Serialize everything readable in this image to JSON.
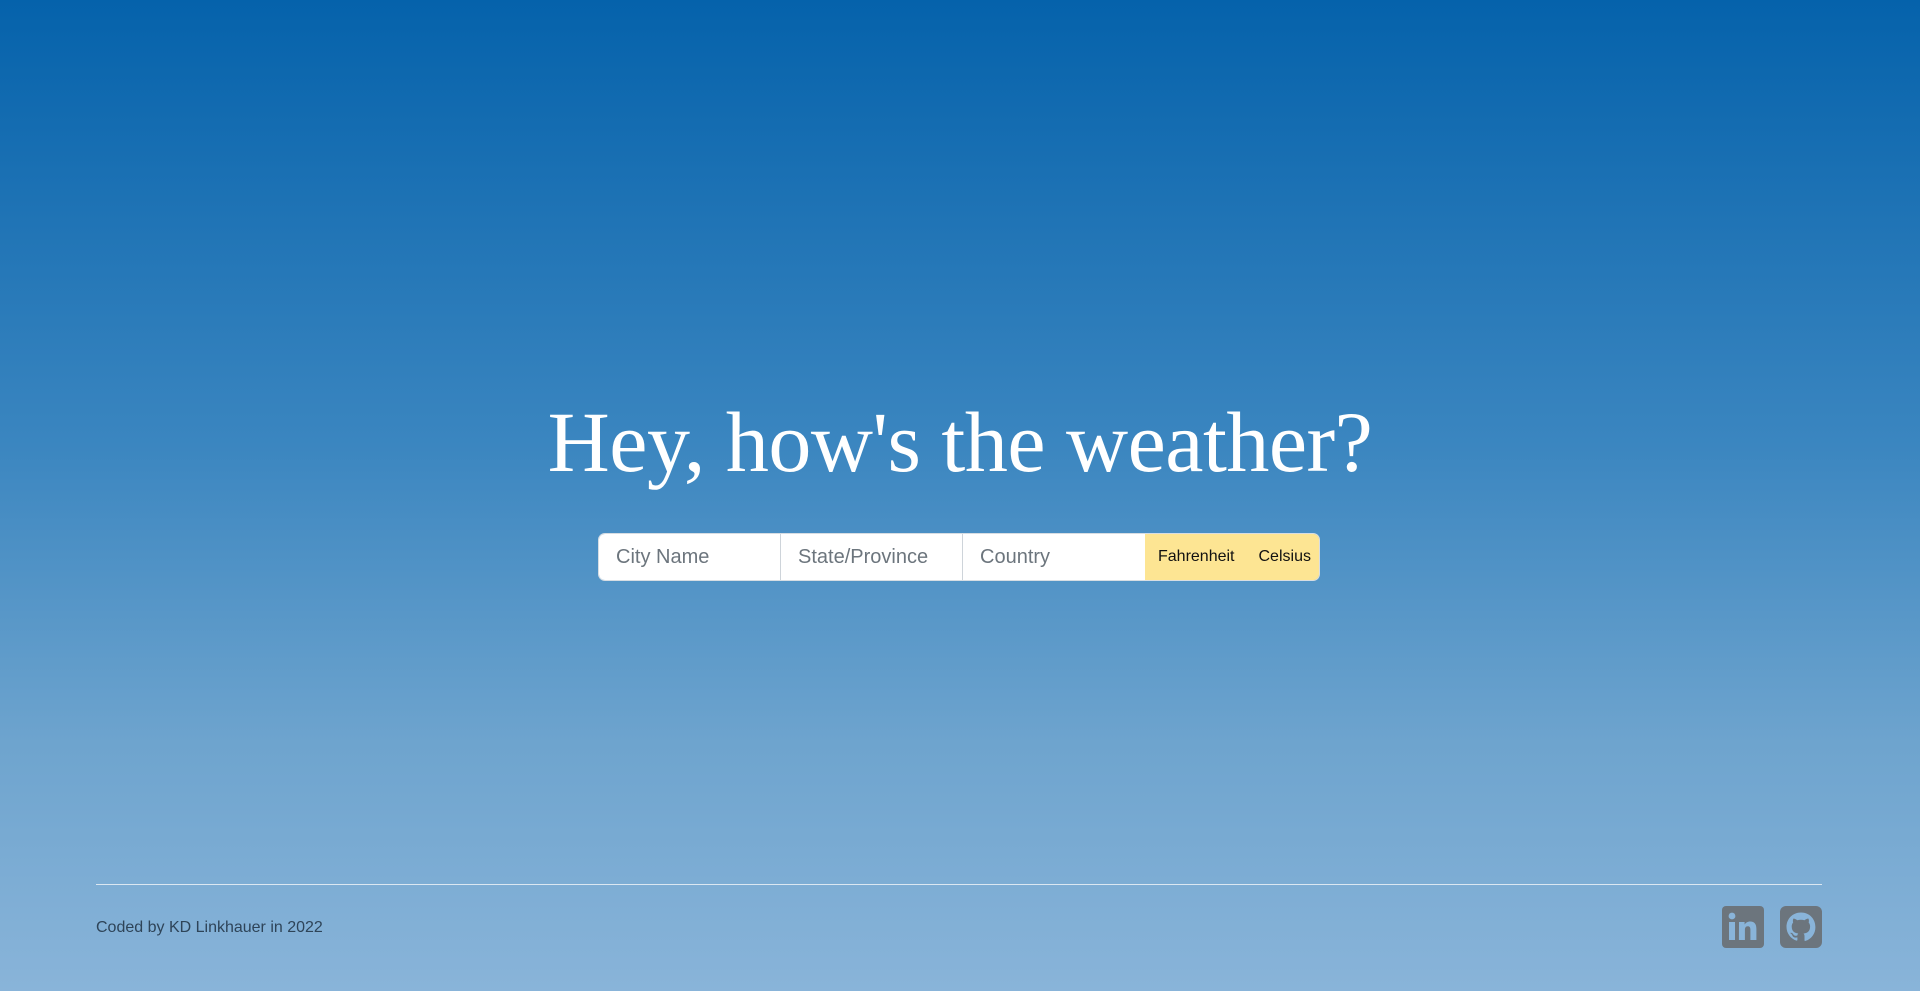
{
  "hero": {
    "headline": "Hey, how's the weather?"
  },
  "search": {
    "city_placeholder": "City Name",
    "state_placeholder": "State/Province",
    "country_placeholder": "Country",
    "fahrenheit_label": "Fahrenheit",
    "celsius_label": "Celsius"
  },
  "footer": {
    "credit": "Coded by KD Linkhauer in 2022",
    "socials": [
      {
        "icon": "linkedin-icon",
        "label": "in"
      },
      {
        "icon": "github-icon"
      }
    ]
  },
  "colors": {
    "gradient_top": "#0562ab",
    "gradient_bottom": "#89b4d9",
    "unit_button": "#fde593",
    "social_icon": "#6c757d"
  }
}
